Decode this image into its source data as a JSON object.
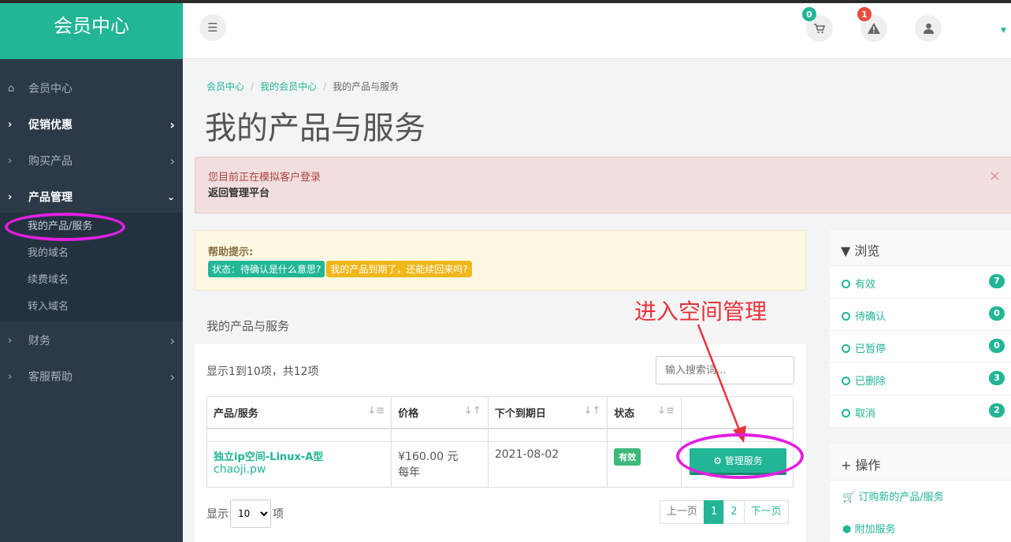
{
  "brand": "会员中心",
  "sidebar": {
    "items": [
      {
        "label": "会员中心",
        "icon": "home-icon"
      },
      {
        "label": "促销优惠",
        "bold": true
      },
      {
        "label": "购买产品"
      },
      {
        "label": "产品管理",
        "bold": true
      },
      {
        "label": "财务"
      },
      {
        "label": "客服帮助"
      }
    ],
    "submenu": [
      "我的产品/服务",
      "我的域名",
      "续费域名",
      "转入域名"
    ]
  },
  "header": {
    "cart_count": "0",
    "alert_count": "1"
  },
  "breadcrumb": [
    "会员中心",
    "我的会员中心",
    "我的产品与服务"
  ],
  "page_title": "我的产品与服务",
  "impersonate_alert": {
    "line1": "您目前正在模拟客户登录",
    "line2": "返回管理平台",
    "close": "×"
  },
  "help": {
    "title": "帮助提示:",
    "tag1": "状态：待确认是什么意思?",
    "tag2": "我的产品到期了，还能续回来吗?"
  },
  "panel": {
    "title": "我的产品与服务",
    "showing": "显示1到10项，共12项",
    "search_placeholder": "输入搜索词..."
  },
  "table": {
    "headers": [
      "产品/服务",
      "价格",
      "下个到期日",
      "状态"
    ],
    "row": {
      "product": "独立ip空间-Linux-A型",
      "domain": "chaoji.pw",
      "price": "¥160.00 元",
      "cycle": "每年",
      "due": "2021-08-02",
      "status": "有效",
      "manage": "⚙ 管理服务"
    }
  },
  "length": {
    "prefix": "显示",
    "value": "10",
    "suffix": "项"
  },
  "pager": {
    "prev": "上一页",
    "p1": "1",
    "p2": "2",
    "next": "下一页"
  },
  "browse": {
    "title": "浏览",
    "items": [
      {
        "label": "有效",
        "count": "7"
      },
      {
        "label": "待确认",
        "count": "0"
      },
      {
        "label": "已暂停",
        "count": "0"
      },
      {
        "label": "已删除",
        "count": "3"
      },
      {
        "label": "取消",
        "count": "2"
      }
    ]
  },
  "actions": {
    "title": "操作",
    "items": [
      "订购新的产品/服务",
      "附加服务"
    ]
  },
  "annotation": "进入空间管理",
  "colors": {
    "accent": "#22b596",
    "sidebar": "#2c3a47",
    "annotation_red": "#e8323a",
    "highlight_magenta": "#e21fe2"
  }
}
